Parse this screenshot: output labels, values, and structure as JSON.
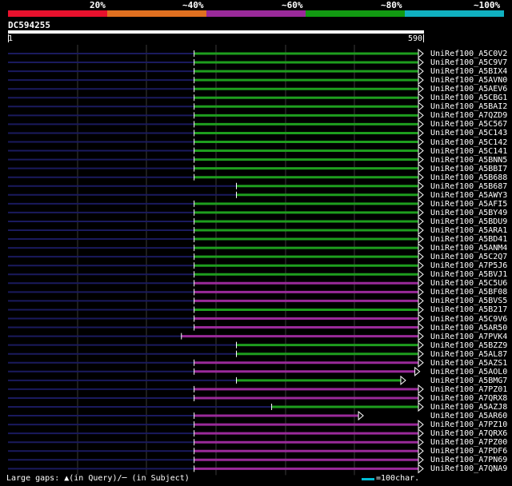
{
  "legend": {
    "items": [
      {
        "label": "20%",
        "color": "#e8112d"
      },
      {
        "label": "~40%",
        "color": "#e07020"
      },
      {
        "label": "~60%",
        "color": "#9a2a9a"
      },
      {
        "label": "~80%",
        "color": "#129a12"
      },
      {
        "label": "~100%",
        "color": "#10b0c0"
      }
    ]
  },
  "query": {
    "id": "DC594255",
    "start": "1",
    "end": "590",
    "length": 590
  },
  "colors": {
    "background": "#000000",
    "alignment_green": "#1e9e1e",
    "alignment_purple": "#9a2a9a",
    "unaligned_navy": "#1a1a5e",
    "grid": "#3a3a3a",
    "scale_cyan": "#00bcd4"
  },
  "hits": [
    {
      "label": "UniRef100_A5C0V2",
      "color": "green",
      "start": 265,
      "end": 590
    },
    {
      "label": "UniRef100_A5C9V7",
      "color": "green",
      "start": 265,
      "end": 590
    },
    {
      "label": "UniRef100_A5BIX4",
      "color": "green",
      "start": 265,
      "end": 590
    },
    {
      "label": "UniRef100_A5AVN0",
      "color": "green",
      "start": 265,
      "end": 590
    },
    {
      "label": "UniRef100_A5AEV6",
      "color": "green",
      "start": 265,
      "end": 590
    },
    {
      "label": "UniRef100_A5CBG1",
      "color": "green",
      "start": 265,
      "end": 590
    },
    {
      "label": "UniRef100_A5BAI2",
      "color": "green",
      "start": 265,
      "end": 590
    },
    {
      "label": "UniRef100_A7QZD9",
      "color": "green",
      "start": 265,
      "end": 590
    },
    {
      "label": "UniRef100_A5C567",
      "color": "green",
      "start": 265,
      "end": 590
    },
    {
      "label": "UniRef100_A5C143",
      "color": "green",
      "start": 265,
      "end": 590
    },
    {
      "label": "UniRef100_A5C142",
      "color": "green",
      "start": 265,
      "end": 590
    },
    {
      "label": "UniRef100_A5C141",
      "color": "green",
      "start": 265,
      "end": 590
    },
    {
      "label": "UniRef100_A5BNN5",
      "color": "green",
      "start": 265,
      "end": 590
    },
    {
      "label": "UniRef100_A5BBI7",
      "color": "green",
      "start": 265,
      "end": 590
    },
    {
      "label": "UniRef100_A5B688",
      "color": "green",
      "start": 265,
      "end": 590
    },
    {
      "label": "UniRef100_A5B687",
      "color": "green",
      "start": 325,
      "end": 590
    },
    {
      "label": "UniRef100_A5AWY3",
      "color": "green",
      "start": 325,
      "end": 590
    },
    {
      "label": "UniRef100_A5AFI5",
      "color": "green",
      "start": 265,
      "end": 590
    },
    {
      "label": "UniRef100_A5BY49",
      "color": "green",
      "start": 265,
      "end": 590
    },
    {
      "label": "UniRef100_A5BDU9",
      "color": "green",
      "start": 265,
      "end": 590
    },
    {
      "label": "UniRef100_A5ARA1",
      "color": "green",
      "start": 265,
      "end": 590
    },
    {
      "label": "UniRef100_A5BD41",
      "color": "green",
      "start": 265,
      "end": 590
    },
    {
      "label": "UniRef100_A5ANM4",
      "color": "green",
      "start": 265,
      "end": 590
    },
    {
      "label": "UniRef100_A5C2Q7",
      "color": "green",
      "start": 265,
      "end": 590
    },
    {
      "label": "UniRef100_A7P5J6",
      "color": "green",
      "start": 265,
      "end": 590
    },
    {
      "label": "UniRef100_A5BVJ1",
      "color": "green",
      "start": 265,
      "end": 590
    },
    {
      "label": "UniRef100_A5C5U6",
      "color": "purple",
      "start": 265,
      "end": 590
    },
    {
      "label": "UniRef100_A5BF08",
      "color": "purple",
      "start": 265,
      "end": 590
    },
    {
      "label": "UniRef100_A5BVS5",
      "color": "purple",
      "start": 265,
      "end": 590
    },
    {
      "label": "UniRef100_A5B217",
      "color": "green",
      "start": 265,
      "end": 590
    },
    {
      "label": "UniRef100_A5C9V6",
      "color": "purple",
      "start": 265,
      "end": 590
    },
    {
      "label": "UniRef100_A5AR50",
      "color": "purple",
      "start": 265,
      "end": 590
    },
    {
      "label": "UniRef100_A7PVK4",
      "color": "purple",
      "start": 247,
      "end": 590
    },
    {
      "label": "UniRef100_A5BZZ9",
      "color": "green",
      "start": 325,
      "end": 590
    },
    {
      "label": "UniRef100_A5AL87",
      "color": "green",
      "start": 325,
      "end": 590
    },
    {
      "label": "UniRef100_A5AZS1",
      "color": "purple",
      "start": 265,
      "end": 590
    },
    {
      "label": "UniRef100_A5AOL0",
      "color": "purple",
      "start": 265,
      "end": 585
    },
    {
      "label": "UniRef100_A5BMG7",
      "color": "green",
      "start": 325,
      "end": 565
    },
    {
      "label": "UniRef100_A7PZ01",
      "color": "purple",
      "start": 265,
      "end": 590
    },
    {
      "label": "UniRef100_A7QRX8",
      "color": "purple",
      "start": 265,
      "end": 590
    },
    {
      "label": "UniRef100_A5AZJ8",
      "color": "green",
      "start": 375,
      "end": 590
    },
    {
      "label": "UniRef100_A5AR60",
      "color": "purple",
      "start": 265,
      "end": 505
    },
    {
      "label": "UniRef100_A7PZ10",
      "color": "purple",
      "start": 265,
      "end": 590
    },
    {
      "label": "UniRef100_A7QRX6",
      "color": "purple",
      "start": 265,
      "end": 590
    },
    {
      "label": "UniRef100_A7PZ00",
      "color": "purple",
      "start": 265,
      "end": 590
    },
    {
      "label": "UniRef100_A7PDF6",
      "color": "purple",
      "start": 265,
      "end": 590
    },
    {
      "label": "UniRef100_A7PN69",
      "color": "purple",
      "start": 265,
      "end": 590
    },
    {
      "label": "UniRef100_A7QNA9",
      "color": "purple",
      "start": 265,
      "end": 590
    }
  ],
  "footer": {
    "large_gaps": "Large gaps: ▲(in Query)/─ (in Subject)",
    "scale": "=100char."
  }
}
